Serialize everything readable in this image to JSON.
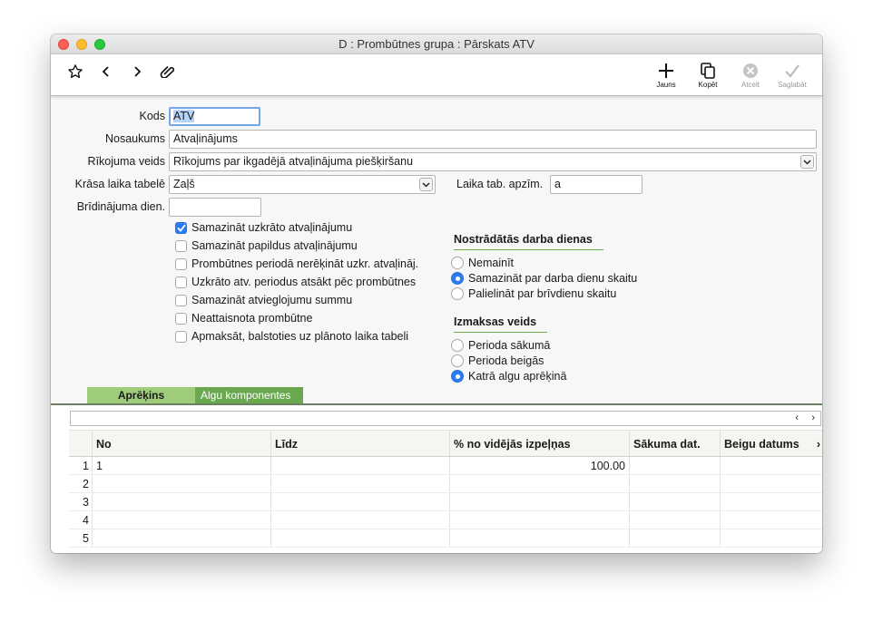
{
  "window": {
    "title": "D : Prombūtnes grupa : Pārskats ATV"
  },
  "toolbar": {
    "new_label": "Jauns",
    "copy_label": "Kopēt",
    "cancel_label": "Atcelt",
    "save_label": "Saglabāt"
  },
  "form": {
    "kods": {
      "label": "Kods",
      "value": "ATV"
    },
    "nosaukums": {
      "label": "Nosaukums",
      "value": "Atvaļinājums"
    },
    "rikojuma_veids": {
      "label": "Rīkojuma veids",
      "value": "Rīkojums par ikgadējā atvaļinājuma piešķiršanu"
    },
    "krasa": {
      "label": "Krāsa laika tabelē",
      "value": "Zaļš"
    },
    "laika_tab": {
      "label": "Laika tab. apzīm.",
      "value": "a"
    },
    "bridinajuma": {
      "label": "Brīdinājuma dien.",
      "value": ""
    }
  },
  "checkboxes": [
    {
      "label": "Samazināt uzkrāto atvaļinājumu",
      "checked": true
    },
    {
      "label": "Samazināt papildus atvaļinājumu",
      "checked": false
    },
    {
      "label": "Prombūtnes periodā nerēķināt uzkr. atvaļināj.",
      "checked": false
    },
    {
      "label": "Uzkrāto atv. periodus atsākt pēc prombūtnes",
      "checked": false
    },
    {
      "label": "Samazināt atvieglojumu summu",
      "checked": false
    },
    {
      "label": "Neattaisnota prombūtne",
      "checked": false
    },
    {
      "label": "Apmaksāt, balstoties uz plānoto laika tabeli",
      "checked": false
    }
  ],
  "nostradatas": {
    "title": "Nostrādātās darba dienas",
    "options": [
      {
        "label": "Nemainīt",
        "selected": false
      },
      {
        "label": "Samazināt par darba dienu skaitu",
        "selected": true
      },
      {
        "label": "Palielināt par brīvdienu skaitu",
        "selected": false
      }
    ]
  },
  "izmaksas": {
    "title": "Izmaksas veids",
    "options": [
      {
        "label": "Perioda sākumā",
        "selected": false
      },
      {
        "label": "Perioda beigās",
        "selected": false
      },
      {
        "label": "Katrā algu aprēķinā",
        "selected": true
      }
    ]
  },
  "tabs": [
    {
      "label": "Aprēķins",
      "active": true
    },
    {
      "label": "Algu komponentes",
      "active": false
    }
  ],
  "grid": {
    "columns": [
      "No",
      "Līdz",
      "% no vidējās izpeļņas",
      "Sākuma dat.",
      "Beigu datums"
    ],
    "rows": [
      {
        "n": "1",
        "no": "1",
        "lidz": "",
        "pct": "100.00",
        "sak": "",
        "beig": ""
      },
      {
        "n": "2",
        "no": "",
        "lidz": "",
        "pct": "",
        "sak": "",
        "beig": ""
      },
      {
        "n": "3",
        "no": "",
        "lidz": "",
        "pct": "",
        "sak": "",
        "beig": ""
      },
      {
        "n": "4",
        "no": "",
        "lidz": "",
        "pct": "",
        "sak": "",
        "beig": ""
      },
      {
        "n": "5",
        "no": "",
        "lidz": "",
        "pct": "",
        "sak": "",
        "beig": ""
      }
    ]
  },
  "colors": {
    "accent": "#2b7cf3",
    "tab_active": "#9fcc7a",
    "tab_inactive": "#6aa84f",
    "group_underline": "#6ab04c"
  }
}
